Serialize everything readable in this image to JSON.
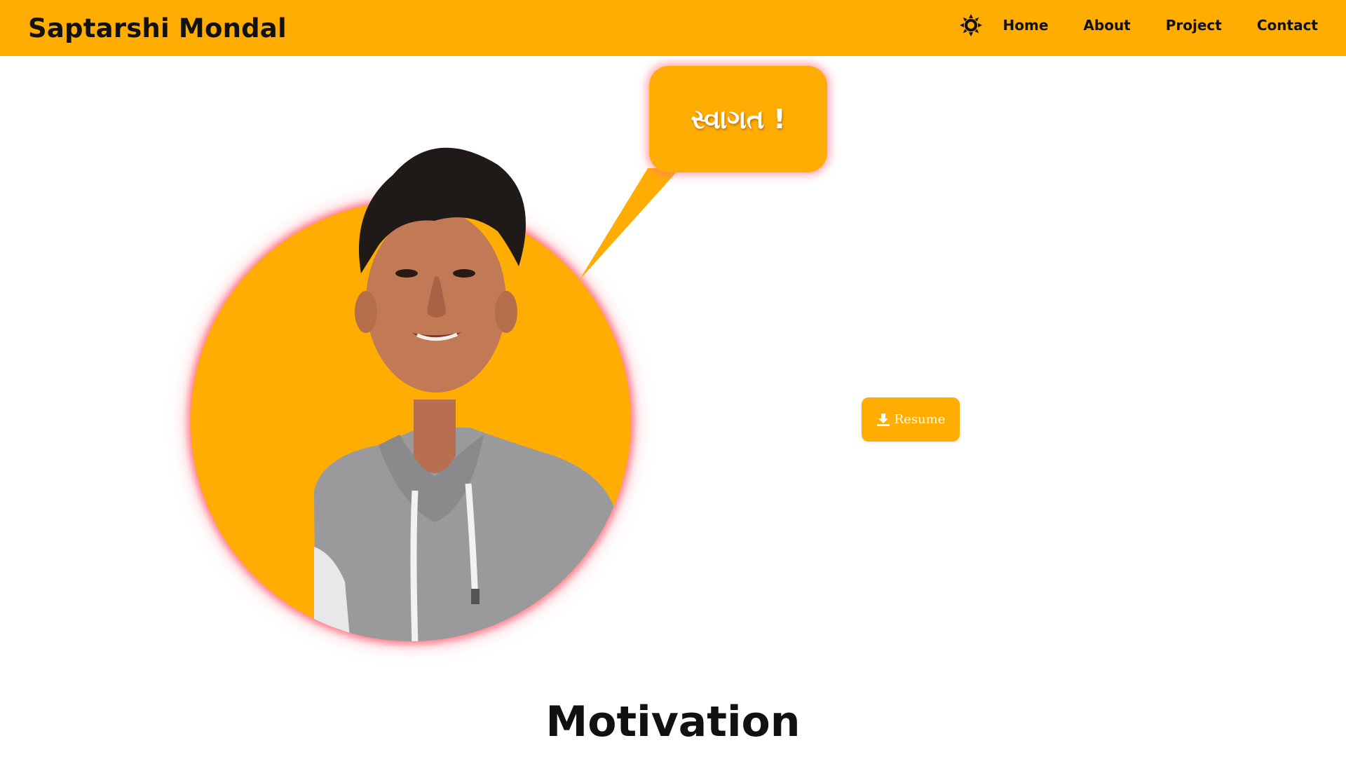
{
  "header": {
    "brand": "Saptarshi Mondal",
    "theme_icon": "sun-icon",
    "nav": [
      {
        "label": "Home"
      },
      {
        "label": "About"
      },
      {
        "label": "Project"
      },
      {
        "label": "Contact"
      }
    ]
  },
  "hero": {
    "greeting": "સ્વાગત !",
    "portrait_icon": "profile-photo",
    "resume": {
      "icon": "download-icon",
      "label": "Resume"
    }
  },
  "section": {
    "title": "Motivation"
  },
  "colors": {
    "accent": "#ffad03",
    "text": "#111111",
    "glow": "#ff5a6e"
  }
}
